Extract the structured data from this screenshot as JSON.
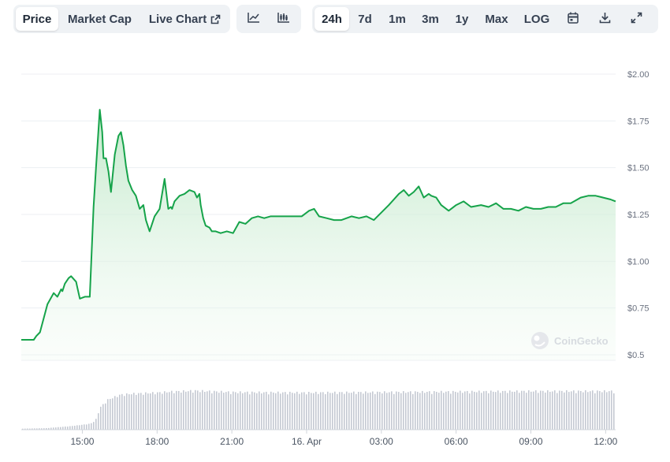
{
  "toolbar": {
    "metric_tabs": [
      {
        "label": "Price",
        "active": true
      },
      {
        "label": "Market Cap",
        "active": false
      },
      {
        "label": "Live Chart",
        "active": false,
        "icon": "external-link-icon"
      }
    ],
    "chart_type_buttons": [
      {
        "icon": "line-chart-icon",
        "active": false
      },
      {
        "icon": "candlestick-chart-icon",
        "active": false
      }
    ],
    "range_tabs": [
      {
        "label": "24h",
        "active": true
      },
      {
        "label": "7d",
        "active": false
      },
      {
        "label": "1m",
        "active": false
      },
      {
        "label": "3m",
        "active": false
      },
      {
        "label": "1y",
        "active": false
      },
      {
        "label": "Max",
        "active": false
      },
      {
        "label": "LOG",
        "active": false
      }
    ],
    "action_icons": [
      "calendar-icon",
      "download-icon",
      "expand-icon"
    ]
  },
  "watermark": "CoinGecko",
  "colors": {
    "line": "#16a34a",
    "fill_top": "#bfe8c8",
    "volume": "#c4c9d2",
    "grid": "#eceff3",
    "axis_text": "#6b7280"
  },
  "chart_data": {
    "type": "area",
    "title": "",
    "xlabel": "",
    "ylabel": "",
    "x_tick_labels": [
      "15:00",
      "18:00",
      "21:00",
      "16. Apr",
      "03:00",
      "06:00",
      "09:00",
      "12:00"
    ],
    "x_tick_hours": [
      15,
      18,
      21,
      24,
      27,
      30,
      33,
      36
    ],
    "y_tick_labels": [
      "$0.5",
      "$0.75",
      "$1.00",
      "$1.25",
      "$1.50",
      "$1.75",
      "$2.00"
    ],
    "y_tick_values": [
      0.5,
      0.75,
      1.0,
      1.25,
      1.5,
      1.75,
      2.0
    ],
    "ylim": [
      0.5,
      2.0
    ],
    "x_unit": "hours",
    "xlim": [
      12.55,
      36.4
    ],
    "grid": true,
    "series": [
      {
        "values_x": [
          12.55,
          13.05,
          13.15,
          13.3,
          13.6,
          13.85,
          14.0,
          14.15,
          14.2,
          14.3,
          14.45,
          14.55,
          14.75,
          14.8,
          14.9,
          15.1,
          15.3,
          15.45,
          15.55,
          15.7,
          15.8,
          15.85,
          15.95,
          16.05,
          16.15,
          16.3,
          16.45,
          16.55,
          16.65,
          16.75,
          16.85,
          17.0,
          17.15,
          17.3,
          17.45,
          17.55,
          17.7,
          17.9,
          18.1,
          18.3,
          18.45,
          18.55,
          18.6,
          18.7,
          18.9,
          19.1,
          19.3,
          19.5,
          19.6,
          19.7,
          19.75,
          19.85,
          19.95,
          20.1,
          20.2,
          20.35,
          20.55,
          20.8,
          21.05,
          21.3,
          21.55,
          21.8,
          22.05,
          22.3,
          22.55,
          22.8,
          23.1,
          23.5,
          23.8,
          24.1,
          24.3,
          24.5,
          24.8,
          25.1,
          25.4,
          25.8,
          26.1,
          26.4,
          26.7,
          27.0,
          27.3,
          27.7,
          27.9,
          28.1,
          28.3,
          28.5,
          28.7,
          28.9,
          29.0,
          29.2,
          29.4,
          29.7,
          30.0,
          30.3,
          30.6,
          31.0,
          31.3,
          31.6,
          31.9,
          32.2,
          32.5,
          32.8,
          33.1,
          33.4,
          33.7,
          34.0,
          34.3,
          34.6,
          35.0,
          35.3,
          35.6,
          35.9,
          36.2,
          36.4
        ],
        "values_y": [
          0.58,
          0.58,
          0.6,
          0.62,
          0.77,
          0.83,
          0.81,
          0.85,
          0.84,
          0.88,
          0.91,
          0.92,
          0.89,
          0.86,
          0.8,
          0.81,
          0.81,
          1.29,
          1.5,
          1.81,
          1.69,
          1.55,
          1.55,
          1.48,
          1.37,
          1.57,
          1.67,
          1.69,
          1.62,
          1.51,
          1.43,
          1.38,
          1.35,
          1.28,
          1.3,
          1.22,
          1.16,
          1.24,
          1.28,
          1.44,
          1.28,
          1.29,
          1.28,
          1.32,
          1.35,
          1.36,
          1.38,
          1.37,
          1.34,
          1.36,
          1.3,
          1.23,
          1.19,
          1.18,
          1.16,
          1.16,
          1.15,
          1.16,
          1.15,
          1.21,
          1.2,
          1.23,
          1.24,
          1.23,
          1.24,
          1.24,
          1.24,
          1.24,
          1.24,
          1.27,
          1.28,
          1.24,
          1.23,
          1.22,
          1.22,
          1.24,
          1.23,
          1.24,
          1.22,
          1.26,
          1.3,
          1.36,
          1.38,
          1.35,
          1.37,
          1.4,
          1.34,
          1.36,
          1.35,
          1.34,
          1.3,
          1.27,
          1.3,
          1.32,
          1.29,
          1.3,
          1.29,
          1.31,
          1.28,
          1.28,
          1.27,
          1.29,
          1.28,
          1.28,
          1.29,
          1.29,
          1.31,
          1.31,
          1.34,
          1.35,
          1.35,
          1.34,
          1.33,
          1.32,
          1.31
        ]
      }
    ],
    "volume": {
      "values_x": [
        12.55,
        13.5,
        14.0,
        14.5,
        15.0,
        15.3,
        15.5,
        15.7,
        16.0,
        16.5,
        17.0,
        18.0,
        18.5,
        19.5,
        21.0,
        24.0,
        27.0,
        30.0,
        33.0,
        36.4
      ],
      "values": [
        0.02,
        0.03,
        0.05,
        0.07,
        0.1,
        0.12,
        0.18,
        0.45,
        0.6,
        0.7,
        0.72,
        0.74,
        0.76,
        0.78,
        0.75,
        0.74,
        0.75,
        0.76,
        0.77,
        0.77
      ]
    }
  }
}
